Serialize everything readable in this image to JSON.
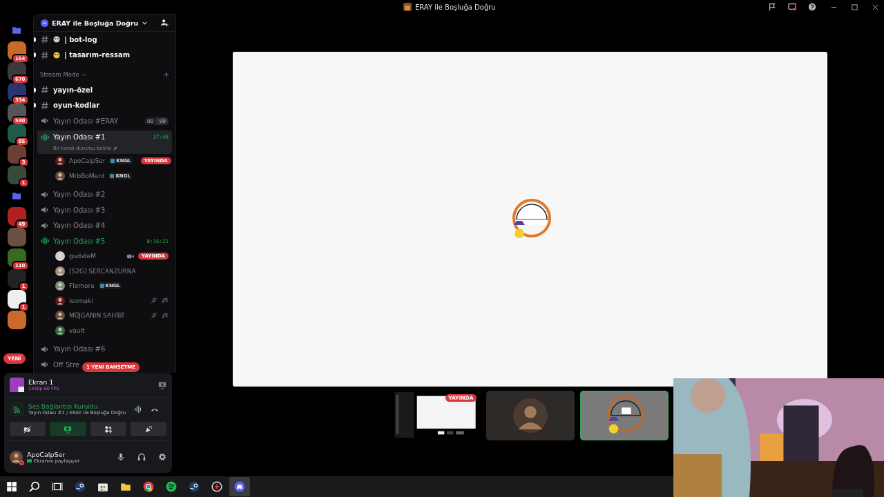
{
  "window": {
    "title": "ERAY ile Boşluğa Doğru"
  },
  "servers": [
    {
      "kind": "folder"
    },
    {
      "kind": "server",
      "badge": "154"
    },
    {
      "kind": "server",
      "badge": "670"
    },
    {
      "kind": "server",
      "badge": "334"
    },
    {
      "kind": "server",
      "badge": "530"
    },
    {
      "kind": "server",
      "badge": "85"
    },
    {
      "kind": "server",
      "badge": "3"
    },
    {
      "kind": "server",
      "badge": "1"
    },
    {
      "kind": "folder"
    },
    {
      "kind": "server",
      "badge": "49"
    },
    {
      "kind": "server"
    },
    {
      "kind": "server",
      "badge": "110"
    },
    {
      "kind": "server",
      "badge": "1"
    },
    {
      "kind": "server",
      "badge": "1"
    },
    {
      "kind": "server"
    }
  ],
  "new_pill": "YENİ",
  "server_name": "ERAY ile Boşluğa Doğru",
  "channels": [
    {
      "kind": "emoji_text",
      "name": "| bot-log",
      "unread": true
    },
    {
      "kind": "emoji_text",
      "name": "| tasarım-ressam",
      "unread": true
    },
    {
      "kind": "category",
      "name": "Stream Mode"
    },
    {
      "kind": "text",
      "name": "yayın-özel",
      "unread": true
    },
    {
      "kind": "text",
      "name": "oyun-kodlar",
      "unread": true
    },
    {
      "kind": "voice",
      "name": "Yayın Odası #ERAY",
      "active": false,
      "selected": false,
      "limit": [
        "00",
        "99"
      ]
    },
    {
      "kind": "voice",
      "name": "Yayın Odası #1",
      "active": true,
      "selected": true,
      "timer": "37:48",
      "status": "Bir kanal durumu belirle",
      "members": [
        {
          "name": "ApoCalpSer",
          "tag": "KNGL",
          "live": "YAYINDA",
          "camera": false,
          "muted": false
        },
        {
          "name": "MrbBoMerd",
          "tag": "KNGL",
          "camera": false,
          "muted": false
        }
      ]
    },
    {
      "kind": "voice",
      "name": "Yayın Odası #2",
      "active": false,
      "selected": false
    },
    {
      "kind": "voice",
      "name": "Yayın Odası #3",
      "active": false,
      "selected": false
    },
    {
      "kind": "voice",
      "name": "Yayın Odası #4",
      "active": false,
      "selected": false
    },
    {
      "kind": "voice",
      "name": "Yayın Odası #5",
      "active": true,
      "selected": false,
      "timer": "8:16:21",
      "members": [
        {
          "name": "gudsteM",
          "live": "YAYINDA",
          "camera": true,
          "muted": false
        },
        {
          "name": "[S2G] SERCANZURNA",
          "camera": false,
          "muted": false
        },
        {
          "name": "Flomore",
          "tag": "KNGL",
          "camera": false,
          "muted": false
        },
        {
          "name": "isomaki",
          "camera": false,
          "muted": true
        },
        {
          "name": "MÜJGANIN SAHİBİ",
          "camera": false,
          "muted": true
        },
        {
          "name": "vault",
          "camera": false,
          "muted": false
        }
      ]
    },
    {
      "kind": "voice",
      "name": "Yayın Odası #6",
      "active": false,
      "selected": false
    },
    {
      "kind": "voice",
      "name": "Off Stre",
      "active": false,
      "selected": false
    }
  ],
  "mention_pill": "1 YENİ BAHSETME",
  "stream_card": {
    "title": "Ekran 1",
    "quality": "1440p 60 FPS"
  },
  "voice_status": {
    "title": "Ses Bağlantısı Kuruldu",
    "location": "Yayın Odası #1 / ERAY ile Boşluğa Doğru"
  },
  "voice_controls": [
    {
      "kind": "camera",
      "on": false
    },
    {
      "kind": "screen",
      "on": true
    },
    {
      "kind": "activity",
      "on": false
    },
    {
      "kind": "soundboard",
      "on": false
    }
  ],
  "user": {
    "name": "ApoCalpSer",
    "status": "Ekranını paylaşıyor"
  },
  "thumbnails": [
    {
      "kind": "screen",
      "live": "YAYINDA",
      "selected": false
    },
    {
      "kind": "avatar",
      "selected": false
    },
    {
      "kind": "duck",
      "selected": true
    }
  ],
  "taskbar": [
    {
      "kind": "windows",
      "selected": false
    },
    {
      "kind": "search",
      "selected": false
    },
    {
      "kind": "taskview",
      "selected": false
    },
    {
      "kind": "steam",
      "selected": false
    },
    {
      "kind": "store",
      "selected": false
    },
    {
      "kind": "folder",
      "selected": false
    },
    {
      "kind": "chrome",
      "selected": false
    },
    {
      "kind": "spotify",
      "selected": false
    },
    {
      "kind": "steam",
      "selected": false
    },
    {
      "kind": "game",
      "selected": false
    },
    {
      "kind": "discord",
      "selected": true
    }
  ]
}
